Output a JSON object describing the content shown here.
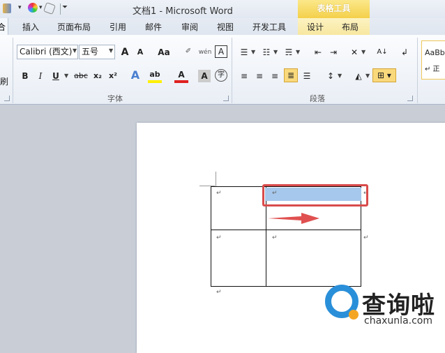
{
  "window": {
    "title": "文档1  -  Microsoft Word",
    "context_group": "表格工具"
  },
  "tabs": {
    "t1": "插入",
    "t2": "页面布局",
    "t3": "引用",
    "t4": "邮件",
    "t5": "审阅",
    "t6": "视图",
    "t7": "开发工具",
    "t8": "设计",
    "t9": "布局",
    "cut": "合"
  },
  "ribbon": {
    "font_name": "Calibri (西文)",
    "font_size": "五号",
    "grow": "A",
    "shrink": "A",
    "change_case": "Aa",
    "phonetic": "wén",
    "clear": "A",
    "bold": "B",
    "italic": "I",
    "underline": "U",
    "strike": "abc",
    "sub": "x₂",
    "sup": "x²",
    "text_effect": "A",
    "highlight": "ab",
    "font_color": "A",
    "char_shade": "A",
    "enclose": "字",
    "font_group": "字体",
    "para_group": "段落",
    "left_cut": "刷",
    "styles_label": "AaBb",
    "styles_sub": "↵ 正"
  },
  "doc": {
    "cell_mark": "↵"
  },
  "watermark": {
    "name": "查询啦",
    "url": "chaxunla.com"
  },
  "colors": {
    "accent": "#f4d04a",
    "selection": "#a6c8ec",
    "highlight_box": "#d94b4b",
    "arrow": "#e05050"
  }
}
